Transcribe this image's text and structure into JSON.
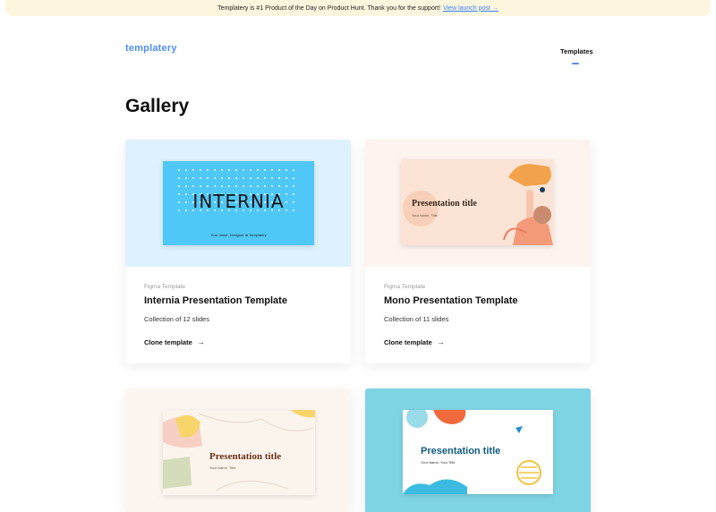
{
  "banner": {
    "text": "Templatery is #1 Product of the Day on Product Hunt. Thank you for the support!",
    "link": "View launch post →"
  },
  "header": {
    "logo": "templatery",
    "nav_templates": "Templates"
  },
  "page_title": "Gallery",
  "cards": [
    {
      "type": "Figma Template",
      "title": "Internia Presentation Template",
      "slides": "Collection of 12 slides",
      "clone": "Clone template",
      "arrow": "→",
      "thumb_bg": "#def2fd",
      "slide_title": "INTERNIA",
      "slide_sub": "Your name, Designer at Templatery"
    },
    {
      "type": "Figma Template",
      "title": "Mono Presentation Template",
      "slides": "Collection of 11 slides",
      "clone": "Clone template",
      "arrow": "→",
      "thumb_bg": "#fdf4ef",
      "slide_title": "Presentation title",
      "slide_sub": "Your name, Title"
    },
    {
      "thumb_bg": "#fdf6f0",
      "slide_title": "Presentation title",
      "slide_sub": "Your Name, Title"
    },
    {
      "thumb_bg": "#7fd4e4",
      "slide_title": "Presentation title",
      "slide_sub": "Your Name, Your Title"
    }
  ],
  "colors": {
    "accent": "#4f8ef7",
    "internia_slide": "#4fc8f7",
    "banner_bg": "#fdf6df"
  },
  "icons": [
    "arrow-right-icon"
  ]
}
